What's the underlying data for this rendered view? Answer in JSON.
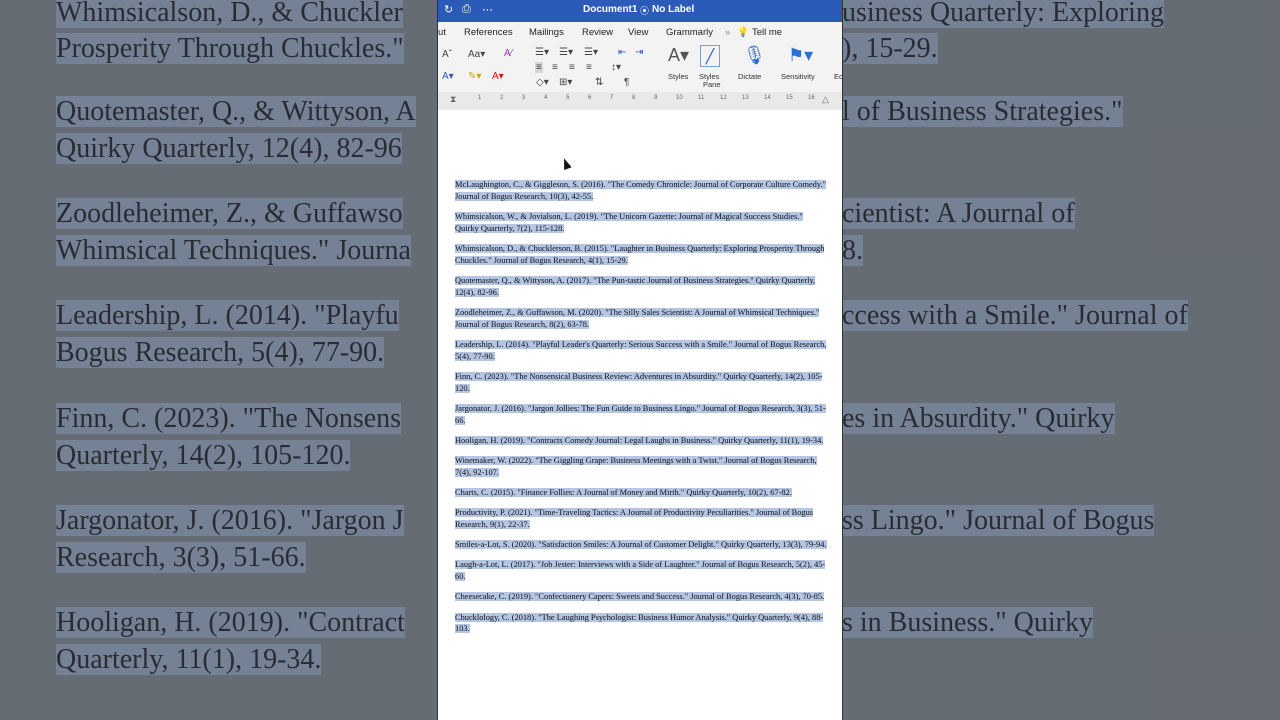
{
  "window": {
    "title": "Document1",
    "label_status": "No Label"
  },
  "ribbon_tabs": [
    "ut",
    "References",
    "Mailings",
    "Review",
    "View",
    "Grammarly",
    "Tell me"
  ],
  "ribbon": {
    "styles": "Styles",
    "styles_pane_l1": "Styles",
    "styles_pane_l2": "Pane",
    "dictate": "Dictate",
    "sensitivity": "Sensitivity",
    "editor_partial": "Ec"
  },
  "ruler_numbers": [
    "1",
    "2",
    "3",
    "4",
    "5",
    "6",
    "7",
    "8",
    "9",
    "10",
    "11",
    "12",
    "13",
    "14",
    "15",
    "16"
  ],
  "references": [
    "McLaughington, C., & Giggleson, S. (2016). \"The Comedy Chronicle: Journal of Corporate Culture Comedy.\" Journal of Bogus Research, 10(3), 42-55.",
    "Whimsicalson, W., & Jovialson, L. (2019). \"The Unicorn Gazette: Journal of Magical Success Studies.\" Quirky Quarterly, 7(2), 115-128.",
    "Whimsicalson, D., & Chucklerson, B. (2015). \"Laughter in Business Quarterly: Exploring Prosperity Through Chuckles.\" Journal of Bogus Research, 4(1), 15-29.",
    "Quotemaster, Q., & Wittyson, A. (2017). \"The Pun-tastic Journal of Business Strategies.\" Quirky Quarterly, 12(4), 82-96.",
    "Zoodleheimer, Z., & Guffawson, M. (2020). \"The Silly Sales Scientist: A Journal of Whimsical Techniques.\" Journal of Bogus Research, 8(2), 63-78.",
    "Leadership, L. (2014). \"Playful Leader's Quarterly: Serious Success with a Smile.\" Journal of Bogus Research, 5(4), 77-90.",
    "Finn, C. (2023). \"The Nonsensical Business Review: Adventures in Absurdity.\" Quirky Quarterly, 14(2), 105-120.",
    "Jargonator, J. (2016). \"Jargon Jollies: The Fun Guide to Business Lingo.\" Journal of Bogus Research, 3(3), 51-66.",
    "Hooligan, H. (2019). \"Contracts Comedy Journal: Legal Laughs in Business.\" Quirky Quarterly, 11(1), 19-34.",
    "Winemaker, W. (2022). \"The Giggling Grape: Business Meetings with a Twist.\" Journal of Bogus Research, 7(4), 92-107.",
    "Charts, C. (2015). \"Finance Follies: A Journal of Money and Mirth.\" Quirky Quarterly, 10(2), 67-82.",
    "Productivity, P. (2021). \"Time-Traveling Tactics: A Journal of Productivity Peculiarities.\" Journal of Bogus Research, 9(1), 22-37.",
    "Smiles-a-Lot, S. (2020). \"Satisfaction Smiles: A Journal of Customer Delight.\" Quirky Quarterly, 13(3), 79-94.",
    "Laugh-a-Lot, L. (2017). \"Job Jester: Interviews with a Side of Laughter.\" Journal of Bogus Research, 5(2), 45-60.",
    "Cheesecake, C. (2019). \"Confectionery Capers: Sweets and Success.\" Journal of Bogus Research, 4(3), 70-85.",
    "Chucklology, C. (2018). \"The Laughing Psychologist: Business Humor Analysis.\" Quirky Quarterly, 9(4), 88-103."
  ],
  "background_zoom_lines": [
    "Whimsicalson, D., & Chuckler",
    "usiness Quarterly: Exploring",
    "Prosperity Through Chuckles.\"",
    "), 15-29.",
    "Quotemaster, Q., & Wittyson, A",
    "l of Business Strategies.\"",
    "Quirky Quarterly, 12(4), 82-96",
    "Zoodleheimer, Z., & Guffawso",
    "cientist: A Journal of",
    "Whimsical Techniques.\" Journa",
    "8.",
    "Leadership, L. (2014). \"Playfu",
    "ccess with a Smile.\" Journal of",
    "Bogus Research, 5(4), 77-90.",
    "Finn, C. (2023). \"The Nonsens",
    "es in Absurdity.\" Quirky",
    "Quarterly, 14(2), 105-120.",
    "Jargonator, J. (2016). \"Jargon J",
    "ss Lingo.\" Journal of Bogus",
    "Research, 3(3), 51-66.",
    "Hooligan, H. (2019). \"Contract",
    "s in Business.\" Quirky",
    "Quarterly, 11(1), 19-34."
  ],
  "colors": {
    "titlebar": "#2b5ab8",
    "selection": "#b4c6e3",
    "ribbon_bg": "#f3f3f3"
  }
}
